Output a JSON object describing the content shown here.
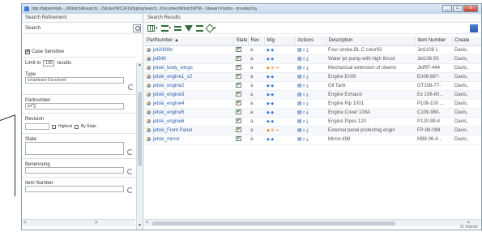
{
  "window": {
    "title": "http://fatpsim/lab-.../Windchill/search/.../Sticker/WC2410/typing/search.../DocumentWindchill?M - Stewart Paxton - provided by",
    "controls": [
      "_",
      "□",
      "x"
    ]
  },
  "left_panel": {
    "header": "Search Refinement",
    "search_label": "Search",
    "case_sensitive_label": "Case Sensitive",
    "case_sensitive_checked": true,
    "limit_prefix": "Limit to",
    "limit_value": "100",
    "limit_suffix": "results",
    "fields": [
      {
        "label": "Type",
        "value": "smartteam Document"
      },
      {
        "label": "Partnumber",
        "value": "jet*]]"
      },
      {
        "label": "Revision",
        "value": ""
      },
      {
        "label": "State",
        "value": ""
      },
      {
        "label": "Benennung",
        "value": ""
      },
      {
        "label": "Item Number",
        "value": ""
      }
    ],
    "revision_options": {
      "highest": "Highest",
      "by_state": "By State"
    }
  },
  "right_panel": {
    "header": "Search Results",
    "footer_count": "11 objects",
    "columns": [
      "PartNumber ▲",
      "State",
      "Rev",
      "Mig",
      "Actions",
      "Description",
      "Item Number",
      "Create"
    ],
    "rows": [
      {
        "part": "jet2008lx",
        "rev": "a",
        "mig": "blue",
        "desc": "Four stroke.BL C color92",
        "item": "Jet1108 L",
        "create": "Davis,"
      },
      {
        "part": "jet54lt",
        "rev": "a",
        "mig": "blue",
        "desc": "Water jet pump with high thrust",
        "item": "Jet108-50",
        "create": "Davis,"
      },
      {
        "part": "jetski_body_wings",
        "rev": "a",
        "mig": "orange",
        "desc": "Mechanical extension of steerin",
        "item": "JetRF-444",
        "create": "Davis,"
      },
      {
        "part": "jetski_engine1_v2",
        "rev": "a",
        "mig": "blue",
        "desc": "Engine En09",
        "item": "En06-887-",
        "create": "Davis,"
      },
      {
        "part": "jetski_engine2",
        "rev": "a",
        "mig": "blue",
        "desc": "Oil Tank",
        "item": "OT108-77-",
        "create": "Davis,"
      },
      {
        "part": "jetski_engine3",
        "rev": "a",
        "mig": "blue",
        "desc": "Engine Exhaust",
        "item": "Ex 108-80...",
        "create": "Davis,"
      },
      {
        "part": "jetski_engine4",
        "rev": "a",
        "mig": "blue",
        "desc": "Engine Pip 1001",
        "item": "P108-100 ...",
        "create": "Davis,"
      },
      {
        "part": "jetski_engine5",
        "rev": "a",
        "mig": "blue",
        "desc": "Engine Cover 109A",
        "item": "C109-980-",
        "create": "Davis,"
      },
      {
        "part": "jetski_engine6",
        "rev": "a",
        "mig": "blue",
        "desc": "Engine Pipes 120",
        "item": "P120-99-4",
        "create": "Davis,"
      },
      {
        "part": "jetski_Front Panel",
        "rev": "a",
        "mig": "orange",
        "desc": "External panel protecting engin",
        "item": "FP-98-098",
        "create": "Davis,"
      },
      {
        "part": "jetski_mirror",
        "rev": "a",
        "mig": "blue",
        "desc": "Mirror-k98",
        "item": "M98-06-4...",
        "create": "Davis,"
      }
    ]
  }
}
